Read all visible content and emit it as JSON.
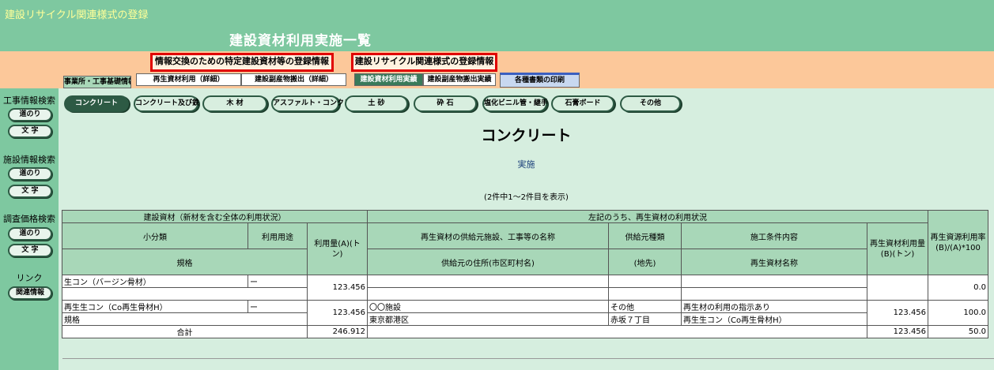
{
  "app_title": "建設リサイクル関連様式の登録",
  "page_title": "建設資材利用実施一覧",
  "tabs": {
    "jigyosho": "事業所・工事基礎情報",
    "group1": "情報交換のための特定建設資材等の登録情報",
    "saisei_riyo": "再生資材利用（詳細）",
    "fukusanbutsu": "建設副産物搬出（詳細）",
    "group2": "建設リサイクル関連様式の登録情報",
    "shizai_jisseki": "建設資材利用実績",
    "fukusanbutsu_jisseki": "建設副産物搬出実績",
    "print": "各種書類の印刷"
  },
  "sidebar": {
    "koji_search": "工事情報検索",
    "shisetsu_search": "施設情報検索",
    "chosa_search": "調査価格検索",
    "michinori": "道のり",
    "moji": "文 字",
    "link": "リンク",
    "related": "関連情報"
  },
  "categories": [
    "コンクリート",
    "コンクリート及び鉄",
    "木 材",
    "アスファルト・コンクリート",
    "土 砂",
    "砕 石",
    "塩化ビニル管・継手",
    "石膏ボード",
    "その他"
  ],
  "category_heading": "コンクリート",
  "status": "実施",
  "count_text": "(2件中1～2件目を表示)",
  "table": {
    "h_kenzai": "建設資材（新材を含む全体の利用状況）",
    "h_saisei_group": "左記のうち、再生資材の利用状況",
    "h_rate": "再生資源利用率(B)/(A)*100",
    "h_shobunrui": "小分類",
    "h_riyoto": "利用用途",
    "h_riyoryo": "利用量(A)(トン)",
    "h_kyokyu": "再生資材の供給元施設、工事等の名称",
    "h_kyokyu_type": "供給元種類",
    "h_seko": "施工条件内容",
    "h_saisei_ryo": "再生資材利用量(B)(トン)",
    "h_kikaku": "規格",
    "h_address": "供給元の住所(市区町村名)",
    "h_chisaki": "(地先)",
    "h_saisei_name": "再生資材名称",
    "rows": [
      {
        "shobunrui": "生コン（バージン骨材）",
        "riyoto": "ー",
        "kikaku": "",
        "riyoryo": "123.456",
        "kyokyu": "",
        "address": "",
        "kyokyu_type": "",
        "chisaki": "",
        "seko": "",
        "saisei_name": "",
        "saisei_ryo": "",
        "rate": "0.0"
      },
      {
        "shobunrui": "再生生コン（Co再生骨材H）",
        "riyoto": "ー",
        "kikaku": "規格",
        "riyoryo": "123.456",
        "kyokyu": "〇〇施設",
        "address": "東京都港区",
        "kyokyu_type": "その他",
        "chisaki": "赤坂７丁目",
        "seko": "再生材の利用の指示あり",
        "saisei_name": "再生生コン（Co再生骨材H）",
        "saisei_ryo": "123.456",
        "rate": "100.0"
      }
    ],
    "total_label": "合計",
    "total_riyoryo": "246.912",
    "total_saisei": "123.456",
    "total_rate": "50.0"
  }
}
